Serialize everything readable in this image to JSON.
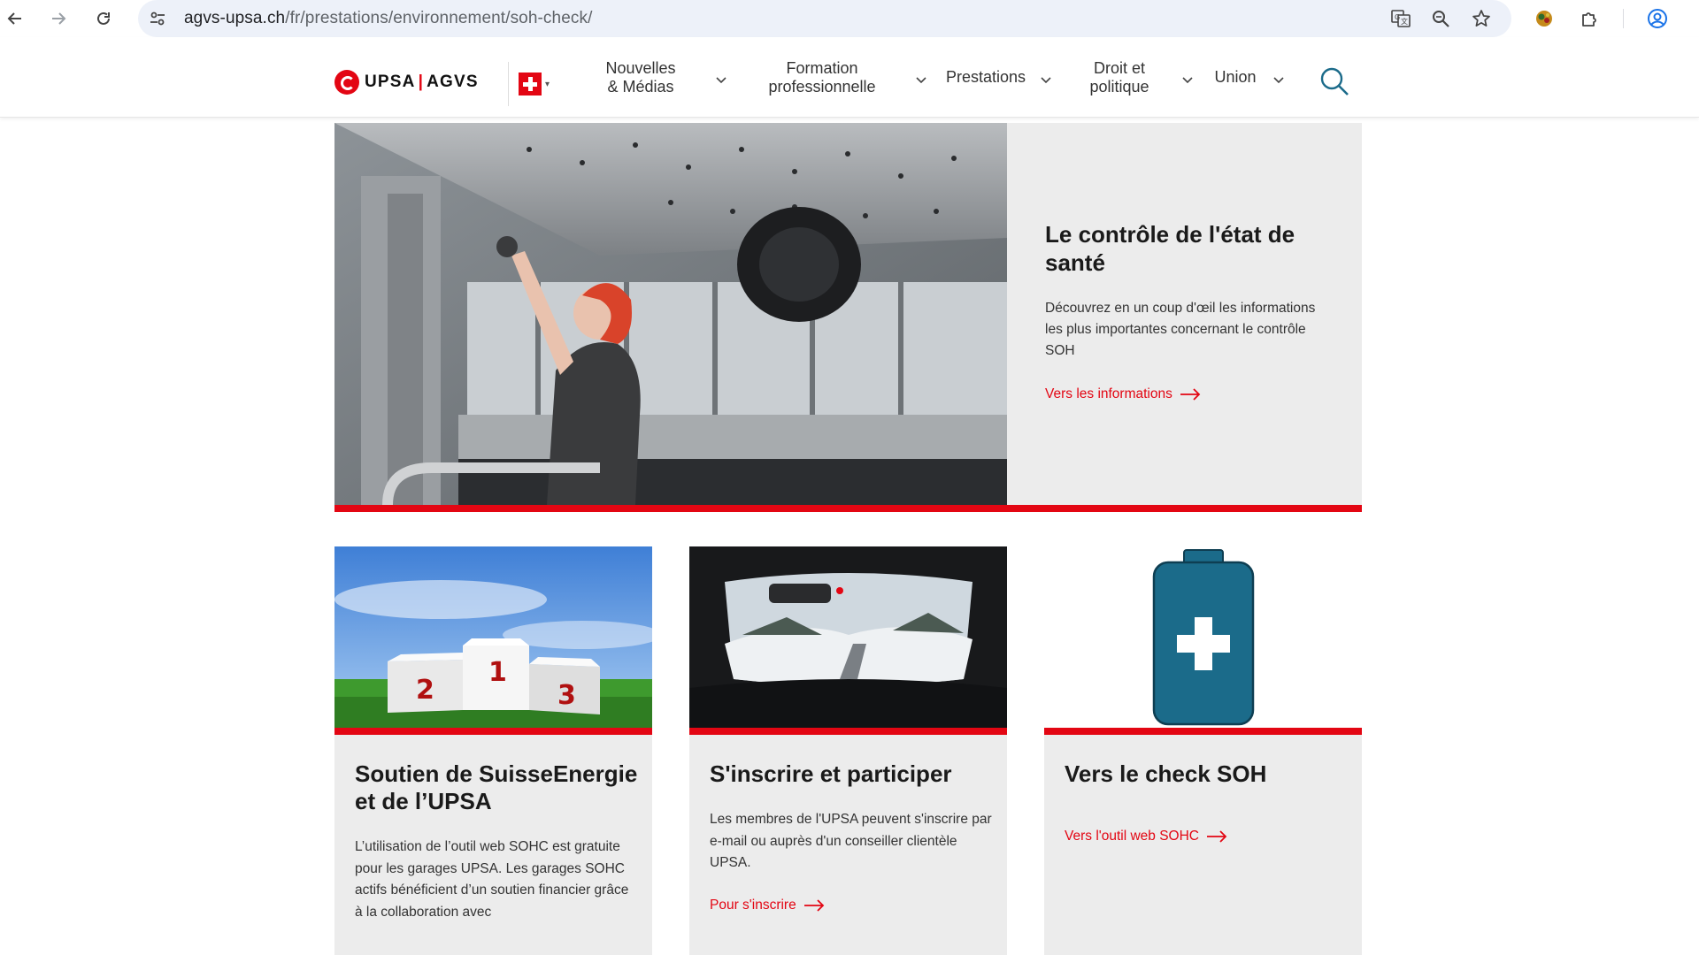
{
  "browser": {
    "url_host": "agvs-upsa.ch",
    "url_path": "/fr/prestations/environnement/soh-check/"
  },
  "header": {
    "logo_left": "UPSA",
    "logo_sep": "|",
    "logo_right": "AGVS",
    "menu": [
      {
        "label_line1": "Nouvelles",
        "label_line2": "& Médias"
      },
      {
        "label_line1": "Formation",
        "label_line2": "professionnelle"
      },
      {
        "label_line1": "Prestations",
        "label_line2": ""
      },
      {
        "label_line1": "Droit et",
        "label_line2": "politique"
      },
      {
        "label_line1": "Union",
        "label_line2": ""
      }
    ]
  },
  "hero": {
    "title": "Le contrôle de l'état de santé",
    "text": "Découvrez en un coup d'œil les informations les plus importantes concernant le contrôle SOH",
    "link": "Vers les informations"
  },
  "cards": [
    {
      "title": "Soutien de SuisseEnergie et de l’UPSA",
      "text": "L’utilisation de l’outil web SOHC est gratuite pour les garages UPSA. Les garages SOHC actifs bénéficient d’un soutien financier grâce à la collaboration avec",
      "podium": [
        "2",
        "1",
        "3"
      ]
    },
    {
      "title": "S'inscrire et participer",
      "text": "Les membres de l'UPSA peuvent s'inscrire par e-mail ou auprès d'un conseiller clientèle UPSA.",
      "link": "Pour s'inscrire"
    },
    {
      "title": "Vers le check SOH",
      "link": "Vers l'outil web SOHC"
    }
  ],
  "colors": {
    "accent": "#e30613",
    "card_bg": "#ececec",
    "battery": "#1b6b8a"
  }
}
